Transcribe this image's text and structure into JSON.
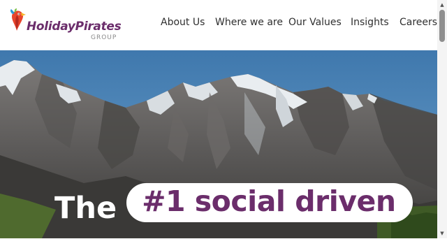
{
  "brand": {
    "name": "HolidayPirates",
    "sub": "GROUP"
  },
  "nav": {
    "items": [
      {
        "label": "About Us"
      },
      {
        "label": "Where we are"
      },
      {
        "label": "Our Values"
      },
      {
        "label": "Insights"
      },
      {
        "label": "Careers"
      }
    ]
  },
  "hero": {
    "headline_white": "The",
    "headline_highlight": "#1 social driven"
  },
  "colors": {
    "brand_purple": "#6b2d6b",
    "sky_blue": "#4f86b8"
  },
  "icons": {
    "logo": "parrot-icon",
    "scroll_up": "scroll-up-arrow-icon",
    "scroll_down": "scroll-down-arrow-icon"
  }
}
